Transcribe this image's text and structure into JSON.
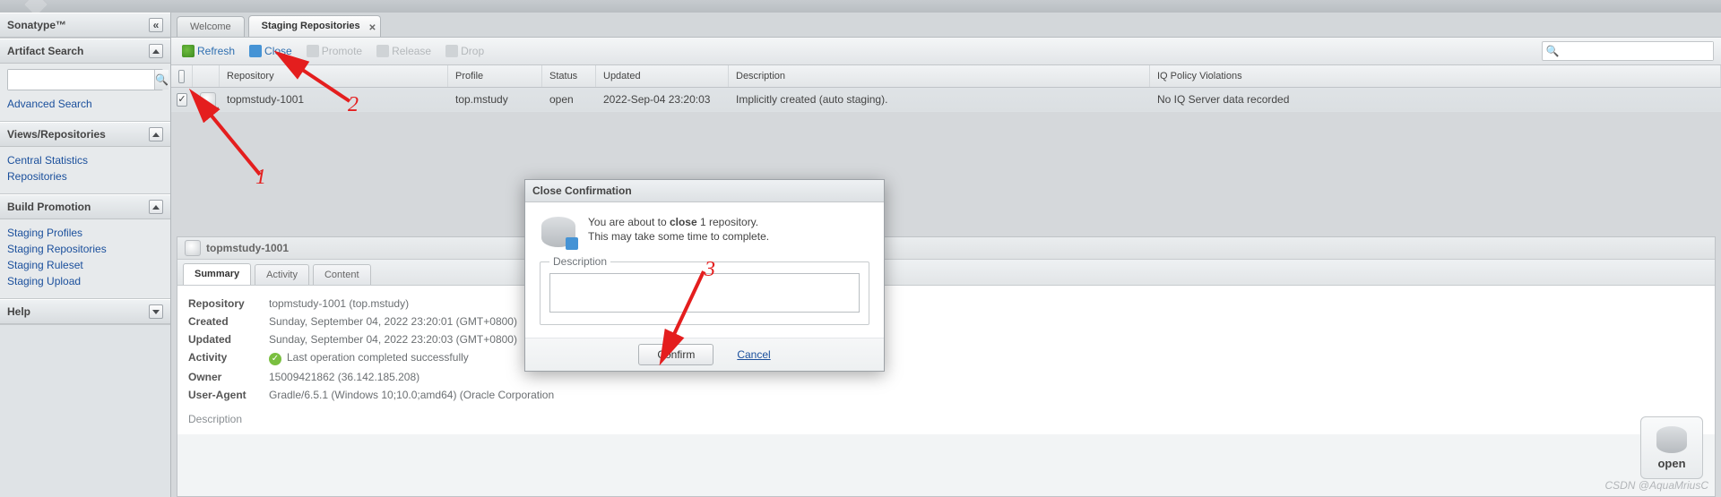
{
  "brand": "Sonatype™",
  "sidebar": {
    "artifactSearch": {
      "title": "Artifact Search",
      "placeholder": "",
      "advanced": "Advanced Search"
    },
    "viewsRepos": {
      "title": "Views/Repositories",
      "links": [
        "Central Statistics",
        "Repositories"
      ]
    },
    "buildPromo": {
      "title": "Build Promotion",
      "links": [
        "Staging Profiles",
        "Staging Repositories",
        "Staging Ruleset",
        "Staging Upload"
      ]
    },
    "help": {
      "title": "Help"
    }
  },
  "tabs": {
    "welcome": "Welcome",
    "staging": "Staging Repositories"
  },
  "toolbar": {
    "refresh": "Refresh",
    "close": "Close",
    "promote": "Promote",
    "release": "Release",
    "drop": "Drop"
  },
  "grid": {
    "headers": {
      "repository": "Repository",
      "profile": "Profile",
      "status": "Status",
      "updated": "Updated",
      "description": "Description",
      "iq": "IQ Policy Violations"
    },
    "row": {
      "repository": "topmstudy-1001",
      "profile": "top.mstudy",
      "status": "open",
      "updated": "2022-Sep-04 23:20:03",
      "description": "Implicitly created (auto staging).",
      "iq": "No IQ Server data recorded"
    }
  },
  "detail": {
    "title": "topmstudy-1001",
    "tabs": {
      "summary": "Summary",
      "activity": "Activity",
      "content": "Content"
    },
    "summary": {
      "repository_label": "Repository",
      "repository": "topmstudy-1001 (top.mstudy)",
      "created_label": "Created",
      "created": "Sunday, September 04, 2022 23:20:01 (GMT+0800)",
      "updated_label": "Updated",
      "updated": "Sunday, September 04, 2022 23:20:03 (GMT+0800)",
      "activity_label": "Activity",
      "activity": "Last operation completed successfully",
      "owner_label": "Owner",
      "owner": "15009421862 (36.142.185.208)",
      "ua_label": "User-Agent",
      "ua": "Gradle/6.5.1 (Windows 10;10.0;amd64) (Oracle Corporation",
      "description_label": "Description"
    }
  },
  "statusBadge": "open",
  "modal": {
    "title": "Close Confirmation",
    "line1_a": "You are about to ",
    "line1_bold": "close",
    "line1_b": " 1 repository.",
    "line2": "This may take some time to complete.",
    "fieldLabel": "Description",
    "confirm": "Confirm",
    "cancel": "Cancel"
  },
  "annotations": {
    "a1": "1",
    "a2": "2",
    "a3": "3"
  },
  "watermark": "CSDN @AquaMriusC"
}
